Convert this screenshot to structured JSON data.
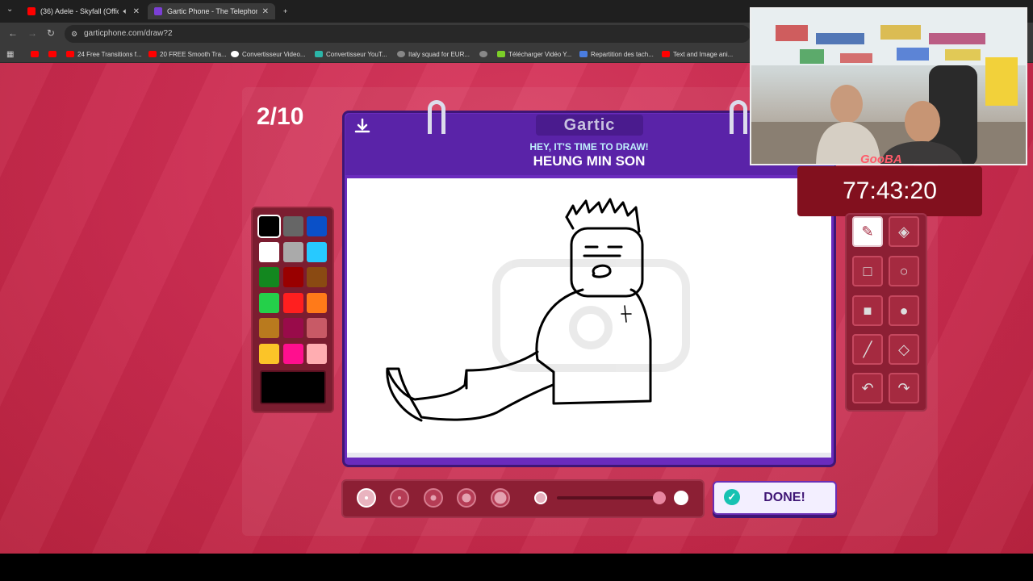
{
  "browser": {
    "tabs": [
      {
        "title": "(36) Adele - Skyfall (Official",
        "icon": "youtube-icon",
        "active": false
      },
      {
        "title": "Gartic Phone - The Telephone G",
        "icon": "gartic-icon",
        "active": true
      }
    ],
    "new_tab_glyph": "+",
    "close_glyph": "✕",
    "url": "garticphone.com/draw?2",
    "bookmarks": [
      "",
      "",
      "24 Free Transitions f...",
      "20 FREE Smooth Tra...",
      "Convertisseur Video...",
      "Convertisseur YouT...",
      "Italy squad for EUR...",
      "",
      "Télécharger Vidéo Y...",
      "Repartition des tach...",
      "Text and Image ani..."
    ]
  },
  "game": {
    "round": "2/10",
    "logo": "Gartic",
    "prompt_line1": "HEY, IT'S TIME TO DRAW!",
    "prompt_line2": "HEUNG MIN SON",
    "done_label": "DONE!",
    "current_color": "#000000",
    "palette": [
      "#000000",
      "#666666",
      "#0a50c8",
      "#ffffff",
      "#aaaaaa",
      "#27c9ff",
      "#13871f",
      "#990000",
      "#8a4a12",
      "#24d04a",
      "#ff1f1f",
      "#ff7a19",
      "#b97a1e",
      "#990b4a",
      "#c85a66",
      "#fbc428",
      "#ff0f8e",
      "#ffadb1"
    ],
    "brush_sizes": 5,
    "selected_brush": 1,
    "opacity_percent": 100,
    "tools": [
      "pencil-icon",
      "eraser-icon",
      "square-outline-icon",
      "circle-outline-icon",
      "square-fill-icon",
      "circle-fill-icon",
      "line-icon",
      "fill-bucket-icon",
      "undo-icon",
      "redo-icon"
    ]
  },
  "stream": {
    "streamer_label": "GooBA",
    "timer": "77:43:20"
  }
}
